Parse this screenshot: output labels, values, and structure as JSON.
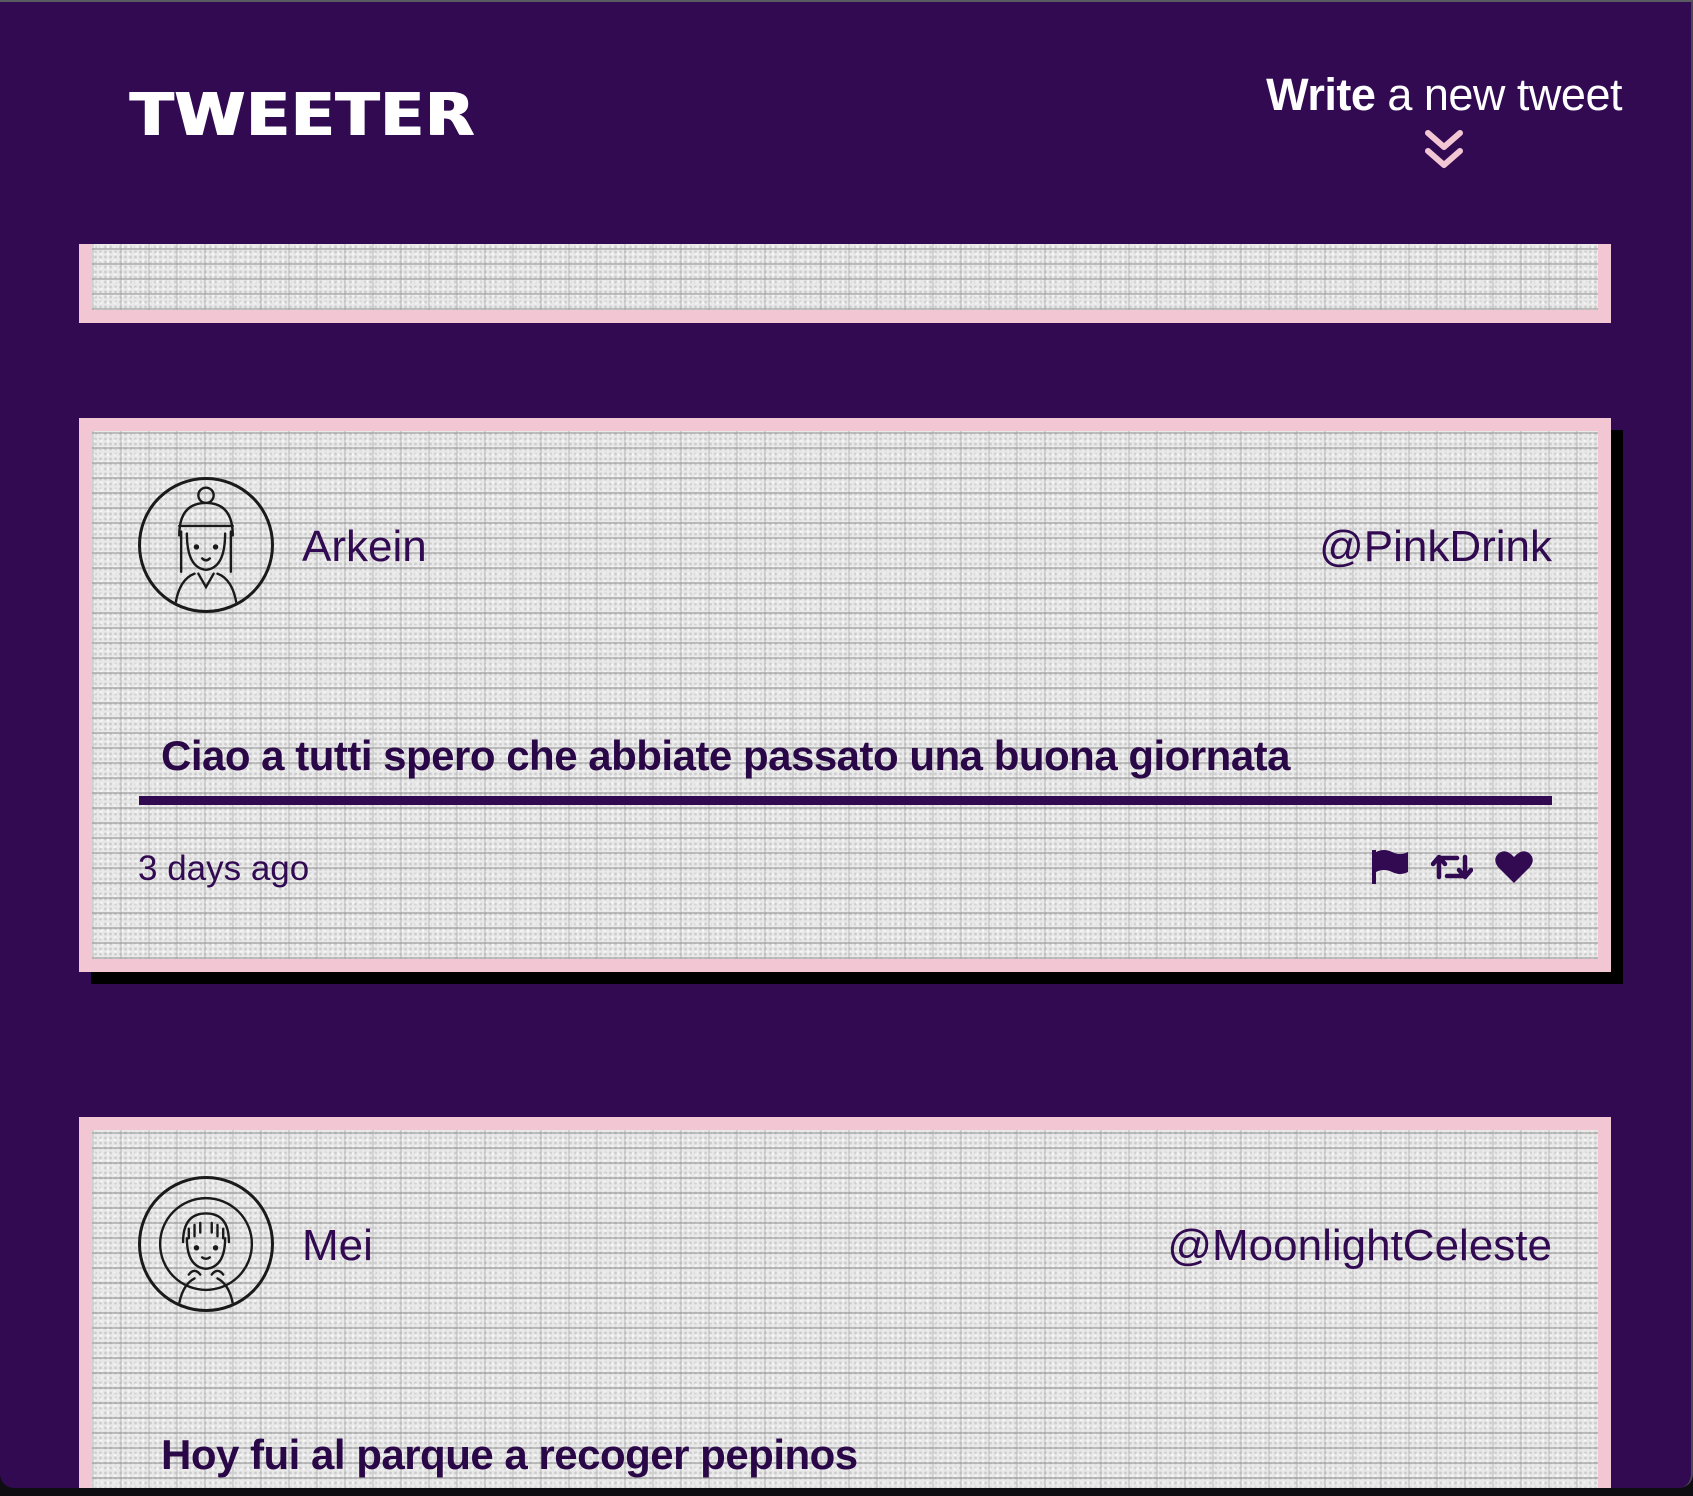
{
  "header": {
    "logo": "TWEETER",
    "compose": {
      "bold": "Write",
      "rest": " a new tweet",
      "icon": "double-chevron-down-icon"
    }
  },
  "tweets": [
    {
      "display_name": "Arkein",
      "handle": "@PinkDrink",
      "text": "Ciao a tutti spero che abbiate passato una buona giornata",
      "timestamp": "3 days ago",
      "actions": [
        "flag-icon",
        "retweet-icon",
        "heart-icon"
      ]
    },
    {
      "display_name": "Mei",
      "handle": "@MoonlightCeleste",
      "text": "Hoy fui al parque a recoger pepinos"
    }
  ],
  "colors": {
    "background": "#310a52",
    "card_border": "#f2c6d2",
    "text": "#310a52",
    "accent": "#f2c6d2",
    "shadow": "#000000"
  }
}
